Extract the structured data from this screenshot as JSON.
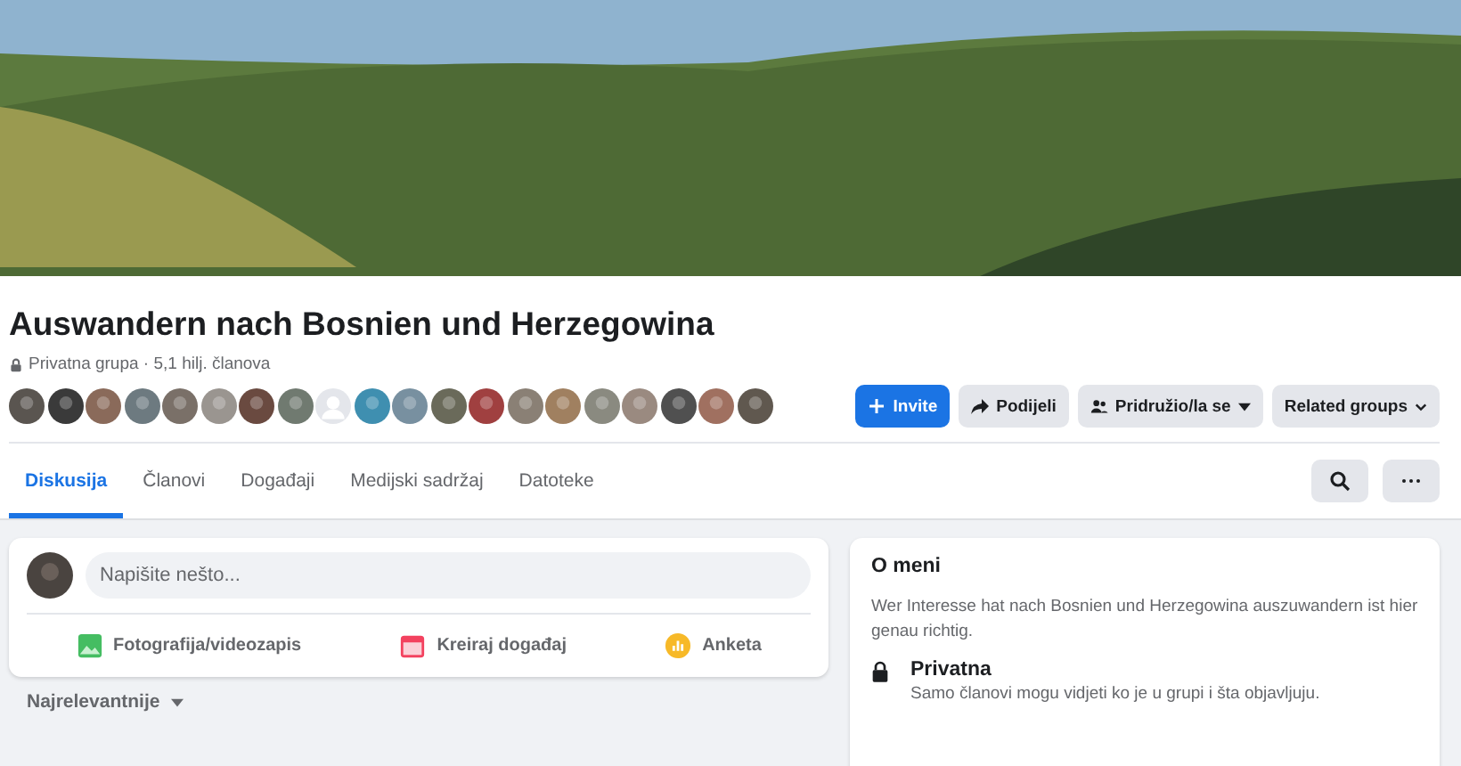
{
  "group": {
    "title": "Auswandern nach Bosnien und Herzegowina",
    "privacy": "Privatna grupa · 5,1 hilj. članova"
  },
  "avatars": [
    {
      "kind": "photo"
    },
    {
      "kind": "photo"
    },
    {
      "kind": "photo"
    },
    {
      "kind": "photo"
    },
    {
      "kind": "photo"
    },
    {
      "kind": "photo"
    },
    {
      "kind": "photo"
    },
    {
      "kind": "photo"
    },
    {
      "kind": "default"
    },
    {
      "kind": "photo"
    },
    {
      "kind": "photo"
    },
    {
      "kind": "photo"
    },
    {
      "kind": "photo"
    },
    {
      "kind": "photo"
    },
    {
      "kind": "photo"
    },
    {
      "kind": "photo"
    },
    {
      "kind": "photo"
    },
    {
      "kind": "photo"
    },
    {
      "kind": "photo"
    },
    {
      "kind": "photo"
    }
  ],
  "actions": [
    {
      "label": "Invite",
      "kind": "primary"
    },
    {
      "label": "Podijeli",
      "kind": "secondary"
    },
    {
      "label": "Pridružio/la se",
      "kind": "secondary"
    },
    {
      "label": "Related groups",
      "kind": "secondary"
    }
  ],
  "tabs": [
    {
      "label": "Diskusija",
      "selected": true
    },
    {
      "label": "Članovi",
      "selected": false
    },
    {
      "label": "Događaji",
      "selected": false
    },
    {
      "label": "Medijski sadržaj",
      "selected": false
    },
    {
      "label": "Datoteke",
      "selected": false
    }
  ],
  "composer": {
    "placeholder": "Napišite nešto...",
    "options": [
      {
        "label": "Fotografija/videozapis"
      },
      {
        "label": "Kreiraj događaj"
      },
      {
        "label": "Anketa"
      }
    ]
  },
  "sort": {
    "label": "Najrelevantnije"
  },
  "about": {
    "title": "O meni",
    "description": "Wer Interesse hat nach Bosnien und Herzegowina auszuwandern ist hier genau richtig.",
    "items": [
      {
        "title": "Privatna",
        "text": "Samo članovi mogu vidjeti ko je u grupi i šta objavljuju."
      }
    ]
  }
}
